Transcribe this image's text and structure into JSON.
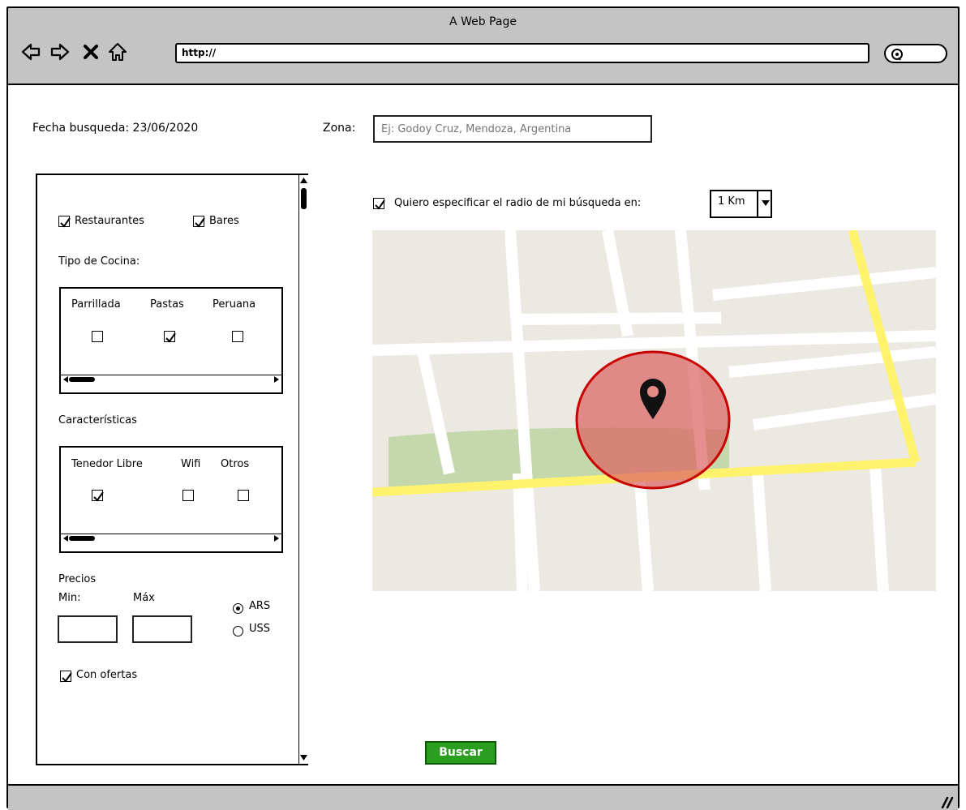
{
  "window": {
    "title": "A Web Page",
    "url": "http://"
  },
  "form": {
    "fecha_label": "Fecha busqueda: 23/06/2020",
    "zona_label": "Zona:",
    "zona_placeholder": "Ej: Godoy Cruz, Mendoza, Argentina"
  },
  "filters": {
    "restaurantes": {
      "label": "Restaurantes",
      "checked": true
    },
    "bares": {
      "label": "Bares",
      "checked": true
    },
    "cocina_title": "Tipo de Cocina:",
    "cocina": [
      {
        "label": "Parrillada",
        "checked": false
      },
      {
        "label": "Pastas",
        "checked": true
      },
      {
        "label": "Peruana",
        "checked": false
      }
    ],
    "carac_title": "Características",
    "carac": [
      {
        "label": "Tenedor Libre",
        "checked": true
      },
      {
        "label": "Wifi",
        "checked": false
      },
      {
        "label": "Otros",
        "checked": false
      }
    ],
    "precios_title": "Precios",
    "min_label": "Min:",
    "max_label": "Máx",
    "currencies": [
      {
        "label": "ARS",
        "selected": true
      },
      {
        "label": "USS",
        "selected": false
      }
    ],
    "ofertas": {
      "label": "Con ofertas",
      "checked": true
    }
  },
  "radius": {
    "label": "Quiero especificar el radio de mi búsqueda en:",
    "checked": true,
    "value": "1 Km"
  },
  "actions": {
    "search_label": "Buscar"
  },
  "colors": {
    "accent": "#2b9e1f",
    "map_road": "#ffffff",
    "map_highway": "#fff36e",
    "map_park": "#c5d8ad",
    "map_bg": "#ece9e2",
    "radius_fill": "#dc6464"
  },
  "icons": [
    "back-arrow-icon",
    "forward-arrow-icon",
    "close-icon",
    "home-icon",
    "search-icon",
    "map-pin-icon",
    "resize-grip-icon"
  ]
}
